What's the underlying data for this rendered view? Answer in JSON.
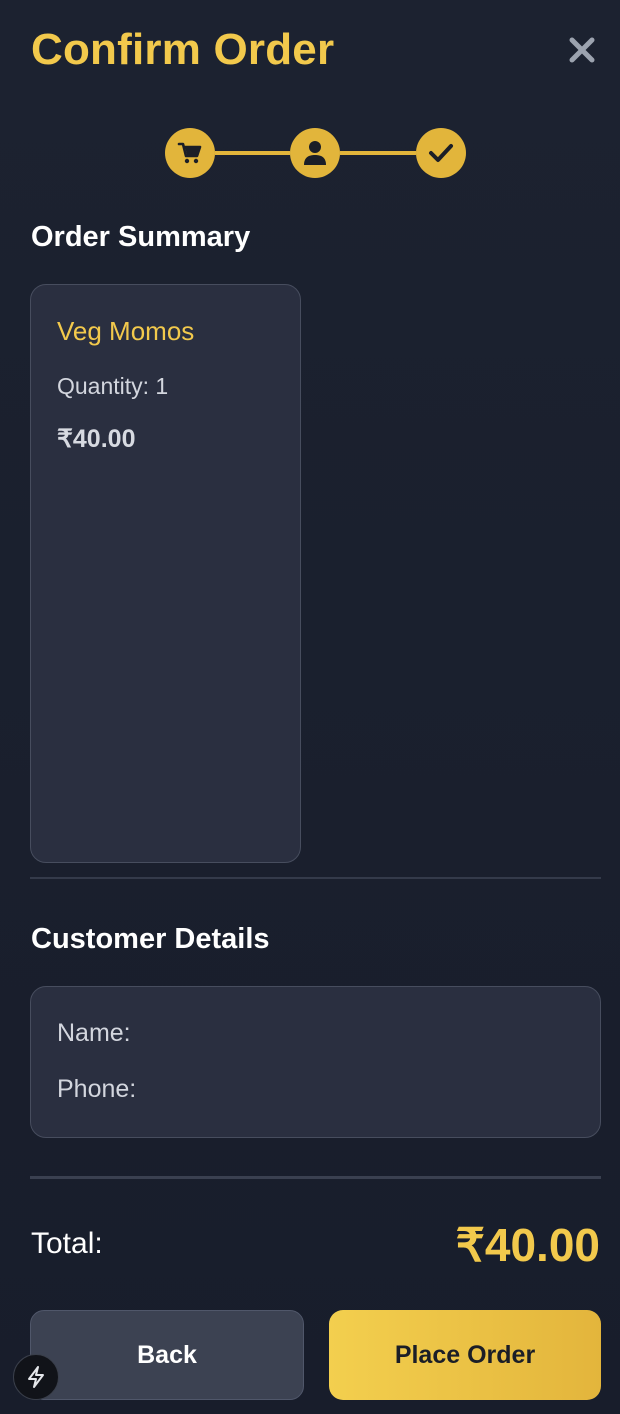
{
  "header": {
    "title": "Confirm Order",
    "close_icon": "close-icon"
  },
  "stepper": {
    "steps": [
      {
        "icon": "cart-icon",
        "state": "complete"
      },
      {
        "icon": "user-icon",
        "state": "complete"
      },
      {
        "icon": "check-icon",
        "state": "complete"
      }
    ]
  },
  "order_summary": {
    "title": "Order Summary",
    "items": [
      {
        "name": "Veg Momos",
        "quantity_text": "Quantity: 1",
        "price": "₹40.00"
      }
    ]
  },
  "customer": {
    "title": "Customer Details",
    "name_label": "Name:",
    "phone_label": "Phone:"
  },
  "total": {
    "label": "Total:",
    "value": "₹40.00"
  },
  "actions": {
    "back_label": "Back",
    "place_label": "Place Order"
  },
  "colors": {
    "accent": "#f2c94c",
    "background": "#1a1f2c",
    "card": "#2a2f40"
  }
}
